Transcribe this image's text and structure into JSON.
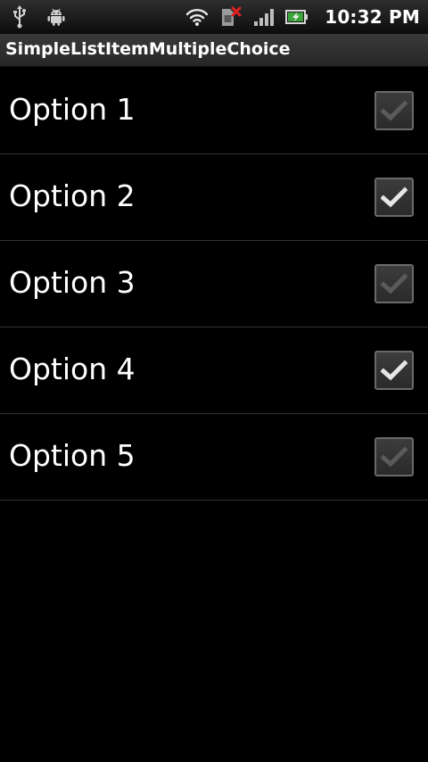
{
  "status_bar": {
    "icons_left": [
      "usb-icon",
      "android-debug-icon"
    ],
    "icons_right": [
      "wifi-icon",
      "no-sim-icon",
      "signal-icon",
      "battery-charging-icon"
    ],
    "time": "10:32 PM"
  },
  "title_bar": {
    "title": "SimpleListItemMultipleChoice"
  },
  "list": {
    "items": [
      {
        "label": "Option 1",
        "checked": false
      },
      {
        "label": "Option 2",
        "checked": true
      },
      {
        "label": "Option 3",
        "checked": false
      },
      {
        "label": "Option 4",
        "checked": true
      },
      {
        "label": "Option 5",
        "checked": false
      }
    ]
  },
  "colors": {
    "background": "#000000",
    "text": "#ffffff",
    "divider": "#333333",
    "check_on": "#e6e6e6",
    "check_off": "#5a5a5a"
  }
}
